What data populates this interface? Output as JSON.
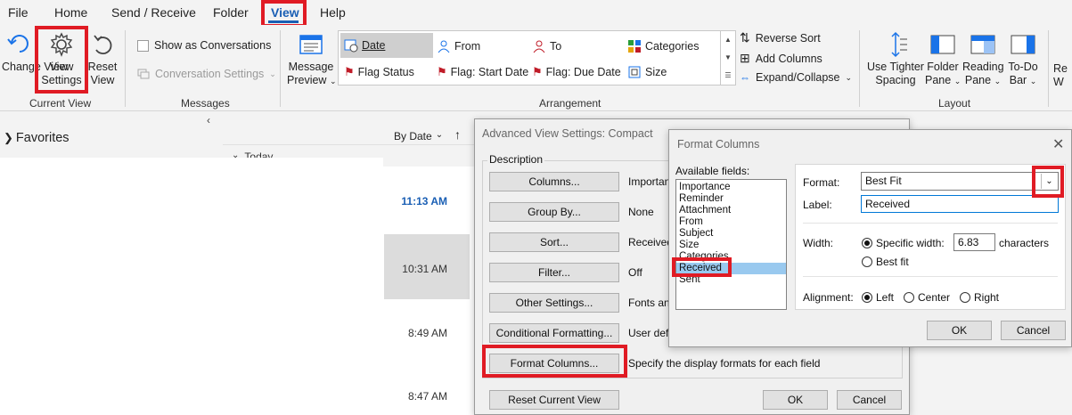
{
  "menu": {
    "file": "File",
    "home": "Home",
    "send_receive": "Send / Receive",
    "folder": "Folder",
    "view": "View",
    "help": "Help"
  },
  "ribbon": {
    "change_view": "Change View",
    "view_settings_1": "View",
    "view_settings_2": "Settings",
    "reset_view_1": "Reset",
    "reset_view_2": "View",
    "current_view_label": "Current View",
    "show_conversations": "Show as Conversations",
    "conversation_settings": "Conversation Settings",
    "messages_label": "Messages",
    "message_preview_1": "Message",
    "message_preview_2": "Preview",
    "arrangement": {
      "date": "Date",
      "from": "From",
      "to": "To",
      "categories": "Categories",
      "flag_status": "Flag Status",
      "flag_start": "Flag: Start Date",
      "flag_due": "Flag: Due Date",
      "size": "Size"
    },
    "arrangement_label": "Arrangement",
    "reverse_sort": "Reverse Sort",
    "add_columns": "Add Columns",
    "expand_collapse": "Expand/Collapse",
    "use_tighter_1": "Use Tighter",
    "use_tighter_2": "Spacing",
    "folder_pane_1": "Folder",
    "folder_pane_2": "Pane",
    "reading_pane_1": "Reading",
    "reading_pane_2": "Pane",
    "todo_bar_1": "To-Do",
    "todo_bar_2": "Bar",
    "layout_label": "Layout",
    "reminders_cut_1": "Re",
    "reminders_cut_2": "W",
    "colors": {
      "accent": "#1a5fb4",
      "highlight": "#e01b24"
    }
  },
  "left_pane": {
    "favorites": "Favorites"
  },
  "message_list": {
    "sort_by": "By Date",
    "group_today": "Today",
    "times": [
      "11:13 AM",
      "10:31 AM",
      "8:49 AM",
      "8:47 AM"
    ]
  },
  "advanced_dialog": {
    "title": "Advanced View Settings: Compact",
    "description_label": "Description",
    "rows": [
      {
        "button": "Columns...",
        "desc": "Importan"
      },
      {
        "button": "Group By...",
        "desc": "None"
      },
      {
        "button": "Sort...",
        "desc": "Received"
      },
      {
        "button": "Filter...",
        "desc": "Off"
      },
      {
        "button": "Other Settings...",
        "desc": "Fonts and"
      },
      {
        "button": "Conditional Formatting...",
        "desc": "User defi"
      },
      {
        "button": "Format Columns...",
        "desc": "Specify the display formats for each field"
      }
    ],
    "reset_button": "Reset Current View",
    "ok": "OK",
    "cancel": "Cancel"
  },
  "format_dialog": {
    "title": "Format Columns",
    "available_fields_label": "Available fields:",
    "fields": [
      "Importance",
      "Reminder",
      "Attachment",
      "From",
      "Subject",
      "Size",
      "Categories",
      "Received",
      "Sent"
    ],
    "selected_field": "Received",
    "format_label": "Format:",
    "format_value": "Best Fit",
    "label_label": "Label:",
    "label_value": "Received",
    "width_label": "Width:",
    "specific_width": "Specific width:",
    "width_value": "6.83",
    "characters": "characters",
    "best_fit": "Best fit",
    "alignment_label": "Alignment:",
    "align_left": "Left",
    "align_center": "Center",
    "align_right": "Right",
    "ok": "OK",
    "cancel": "Cancel"
  }
}
